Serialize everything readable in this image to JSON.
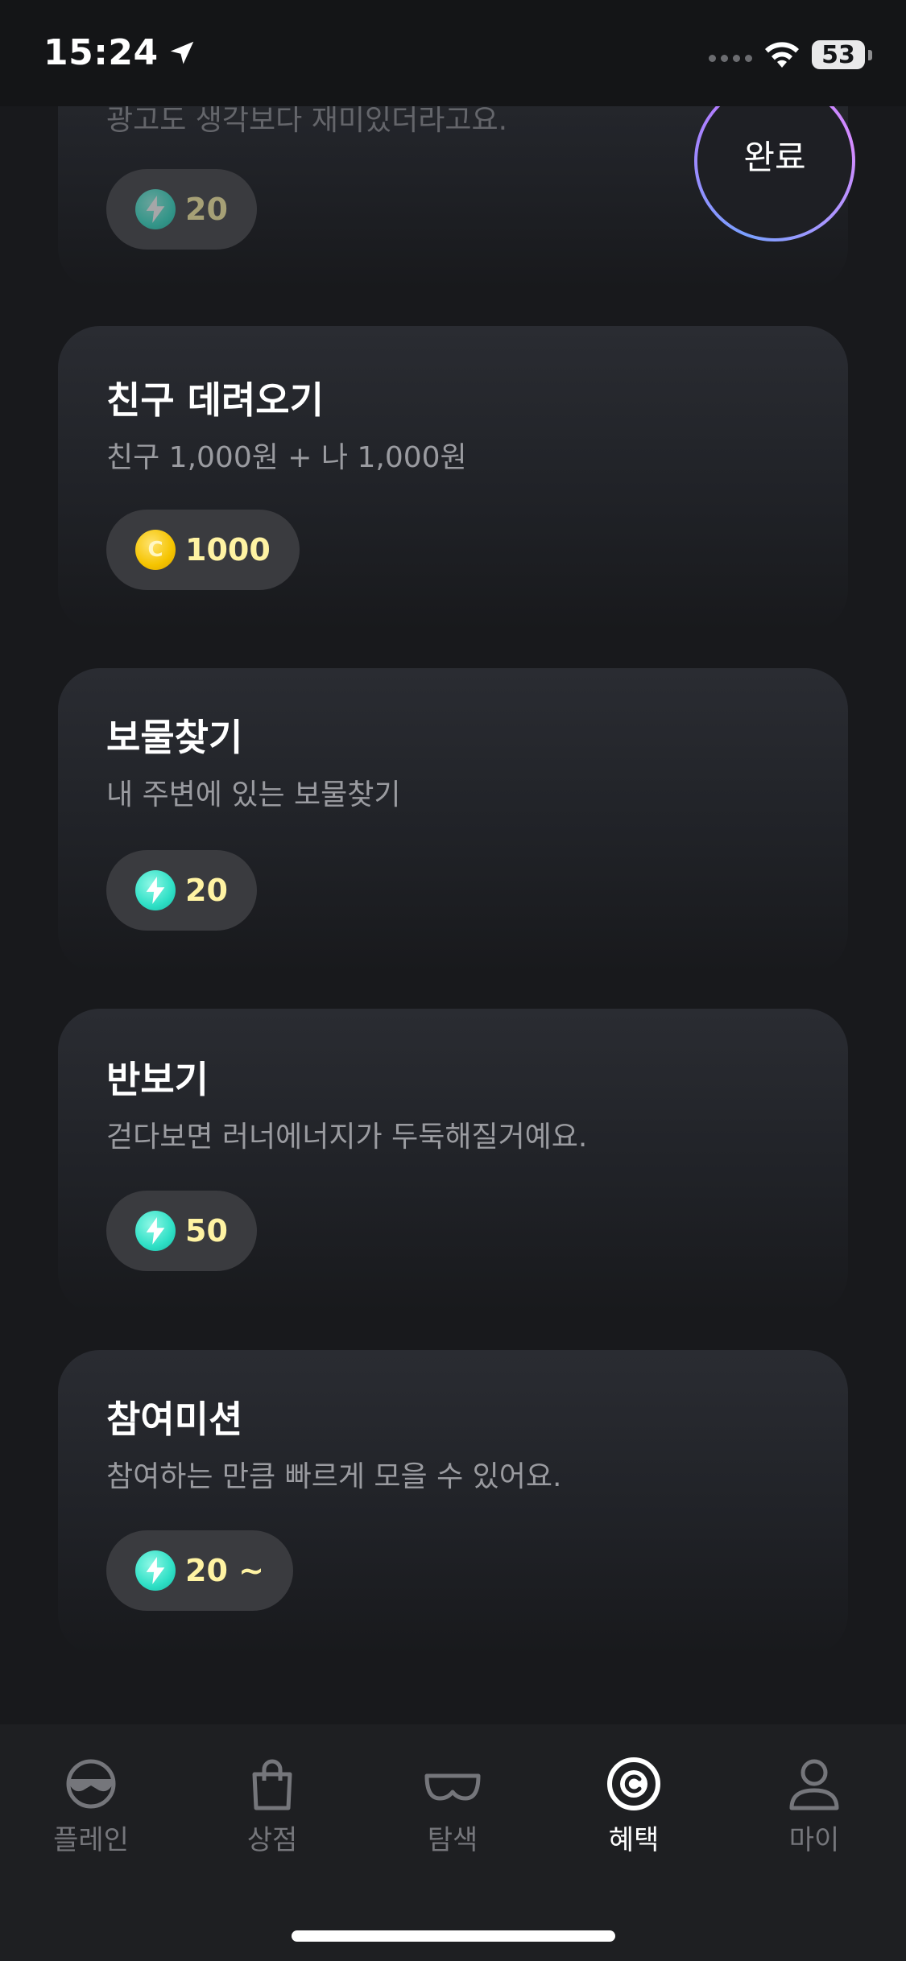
{
  "status_bar": {
    "time": "15:24",
    "battery": "53"
  },
  "cards": [
    {
      "desc": "광고도 생각보다 재미있더라고요.",
      "reward": {
        "type": "energy",
        "value": "20"
      },
      "status_label": "완료"
    },
    {
      "title": "친구 데려오기",
      "desc": "친구 1,000원 + 나 1,000원",
      "reward": {
        "type": "coin",
        "icon_letter": "C",
        "value": "1000"
      }
    },
    {
      "title": "보물찾기",
      "desc": "내 주변에 있는 보물찾기",
      "reward": {
        "type": "energy",
        "value": "20"
      }
    },
    {
      "title": "반보기",
      "desc": "걷다보면 러너에너지가 두둑해질거예요.",
      "reward": {
        "type": "energy",
        "value": "50"
      }
    },
    {
      "title": "참여미션",
      "desc": "참여하는 만큼 빠르게 모을 수 있어요.",
      "reward": {
        "type": "energy",
        "value": "20 ~"
      }
    }
  ],
  "tabs": [
    {
      "label": "플레인",
      "icon": "avatar-sunglasses-icon",
      "active": false
    },
    {
      "label": "상점",
      "icon": "shopping-bag-icon",
      "active": false
    },
    {
      "label": "탐색",
      "icon": "goggles-icon",
      "active": false
    },
    {
      "label": "혜택",
      "icon": "coin-c-icon",
      "active": true
    },
    {
      "label": "마이",
      "icon": "person-icon",
      "active": false
    }
  ],
  "colors": {
    "background": "#18191c",
    "reward_text": "#fff3a3",
    "energy": "#2fe0c6",
    "coin": "#f5c400"
  }
}
